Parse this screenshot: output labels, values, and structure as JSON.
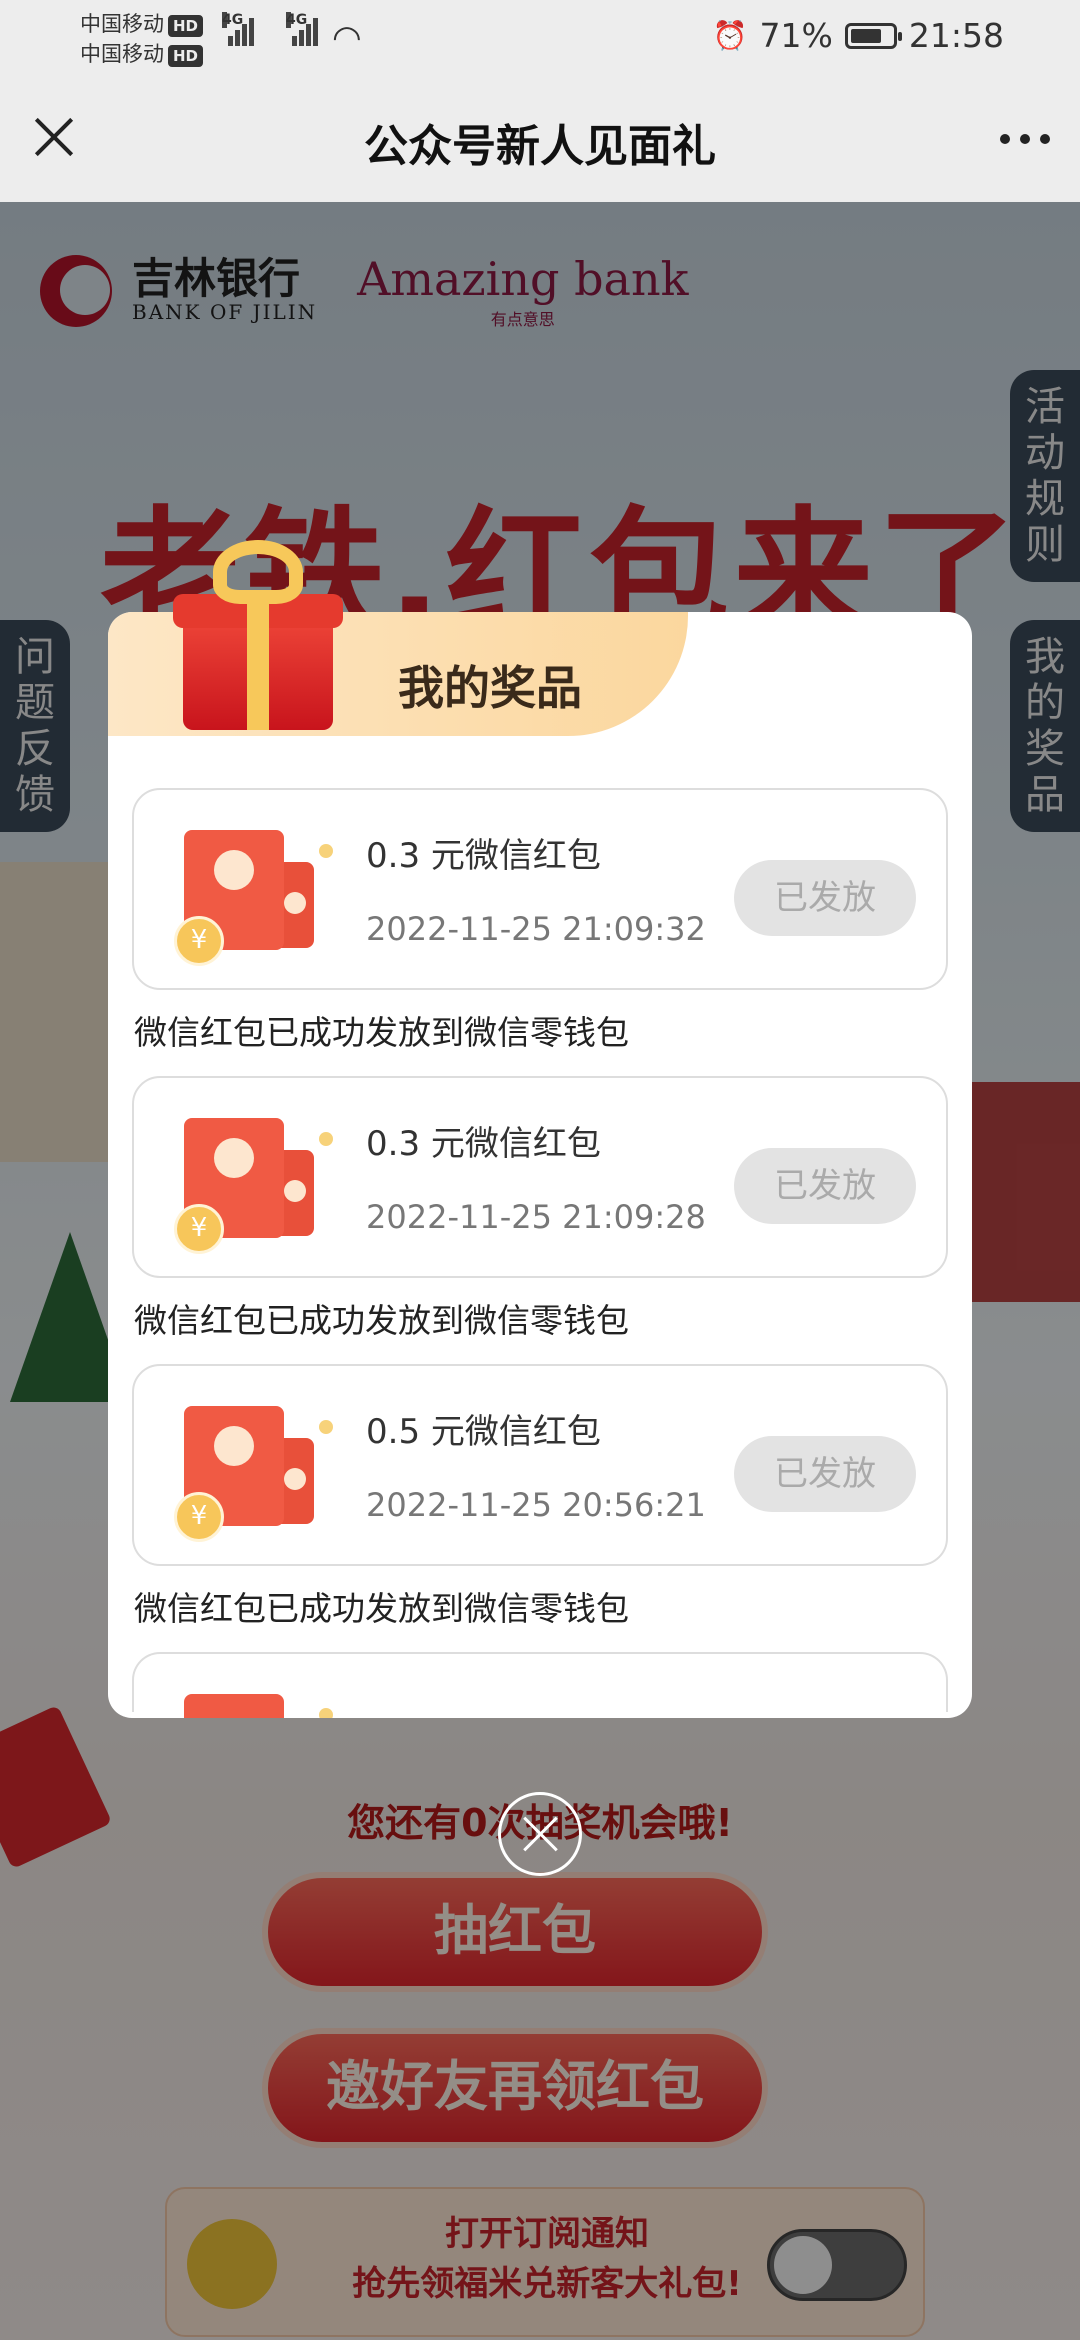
{
  "status_bar": {
    "carrier1": "中国移动",
    "carrier2": "中国移动",
    "hd": "HD",
    "net1": "4G",
    "net2": "4G",
    "battery": "71%",
    "time": "21:58"
  },
  "nav": {
    "title": "公众号新人见面礼"
  },
  "background": {
    "bank_cn": "吉林银行",
    "bank_en": "BANK OF JILIN",
    "amazing": "Amazing bank",
    "amazing_sub": "有点意思",
    "headline": "老铁,红包来了",
    "tab_rules": "活动规则",
    "tab_feedback": "问题反馈",
    "tab_prizes": "我的奖品",
    "chance_text": "您还有0次抽奖机会哦!",
    "draw_button": "抽红包",
    "invite_button": "邀好友再领红包",
    "subscribe_line1": "打开订阅通知",
    "subscribe_line2": "抢先领福米兑新客大礼包!"
  },
  "modal": {
    "title": "我的奖品",
    "coin_symbol": "¥",
    "prizes": [
      {
        "name": "0.3 元微信红包",
        "time": "2022-11-25 21:09:32",
        "status": "已发放",
        "note": "微信红包已成功发放到微信零钱包"
      },
      {
        "name": "0.3 元微信红包",
        "time": "2022-11-25 21:09:28",
        "status": "已发放",
        "note": "微信红包已成功发放到微信零钱包"
      },
      {
        "name": "0.5 元微信红包",
        "time": "2022-11-25 20:56:21",
        "status": "已发放",
        "note": "微信红包已成功发放到微信零钱包"
      }
    ]
  }
}
